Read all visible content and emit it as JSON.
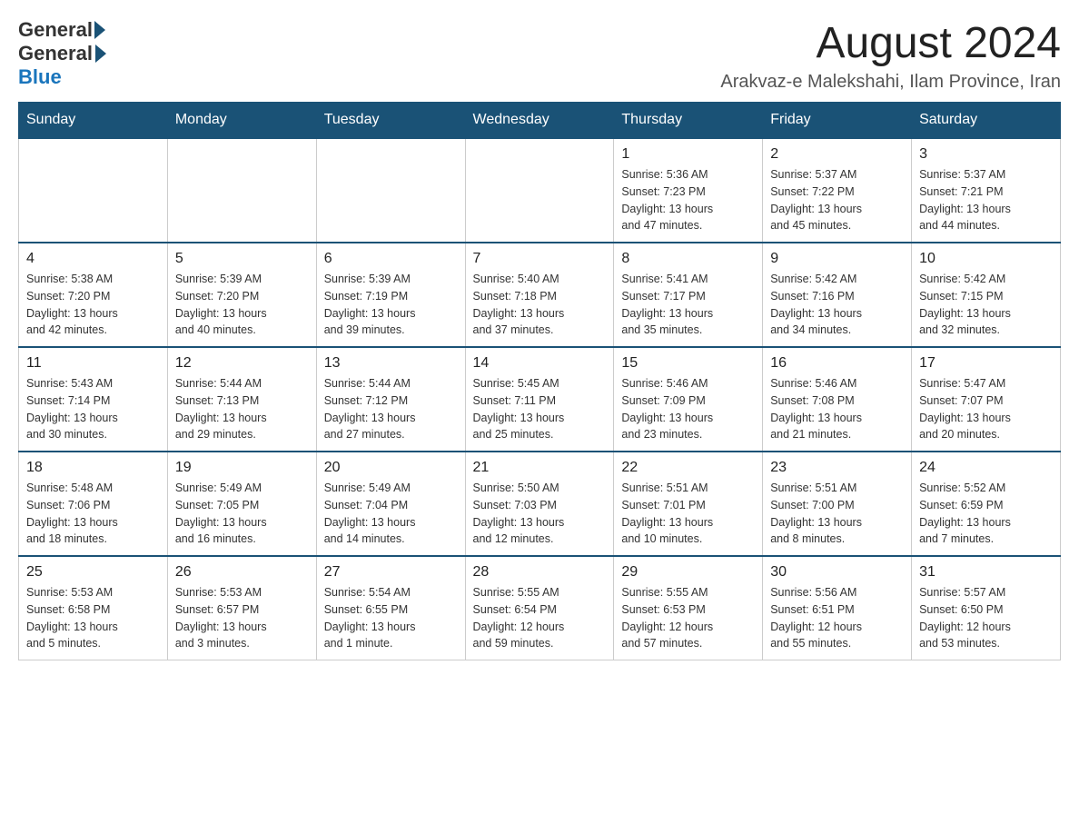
{
  "header": {
    "logo_general": "General",
    "logo_blue": "Blue",
    "month_title": "August 2024",
    "location": "Arakvaz-e Malekshahi, Ilam Province, Iran"
  },
  "days_of_week": [
    "Sunday",
    "Monday",
    "Tuesday",
    "Wednesday",
    "Thursday",
    "Friday",
    "Saturday"
  ],
  "weeks": [
    [
      {
        "day": "",
        "info": ""
      },
      {
        "day": "",
        "info": ""
      },
      {
        "day": "",
        "info": ""
      },
      {
        "day": "",
        "info": ""
      },
      {
        "day": "1",
        "info": "Sunrise: 5:36 AM\nSunset: 7:23 PM\nDaylight: 13 hours\nand 47 minutes."
      },
      {
        "day": "2",
        "info": "Sunrise: 5:37 AM\nSunset: 7:22 PM\nDaylight: 13 hours\nand 45 minutes."
      },
      {
        "day": "3",
        "info": "Sunrise: 5:37 AM\nSunset: 7:21 PM\nDaylight: 13 hours\nand 44 minutes."
      }
    ],
    [
      {
        "day": "4",
        "info": "Sunrise: 5:38 AM\nSunset: 7:20 PM\nDaylight: 13 hours\nand 42 minutes."
      },
      {
        "day": "5",
        "info": "Sunrise: 5:39 AM\nSunset: 7:20 PM\nDaylight: 13 hours\nand 40 minutes."
      },
      {
        "day": "6",
        "info": "Sunrise: 5:39 AM\nSunset: 7:19 PM\nDaylight: 13 hours\nand 39 minutes."
      },
      {
        "day": "7",
        "info": "Sunrise: 5:40 AM\nSunset: 7:18 PM\nDaylight: 13 hours\nand 37 minutes."
      },
      {
        "day": "8",
        "info": "Sunrise: 5:41 AM\nSunset: 7:17 PM\nDaylight: 13 hours\nand 35 minutes."
      },
      {
        "day": "9",
        "info": "Sunrise: 5:42 AM\nSunset: 7:16 PM\nDaylight: 13 hours\nand 34 minutes."
      },
      {
        "day": "10",
        "info": "Sunrise: 5:42 AM\nSunset: 7:15 PM\nDaylight: 13 hours\nand 32 minutes."
      }
    ],
    [
      {
        "day": "11",
        "info": "Sunrise: 5:43 AM\nSunset: 7:14 PM\nDaylight: 13 hours\nand 30 minutes."
      },
      {
        "day": "12",
        "info": "Sunrise: 5:44 AM\nSunset: 7:13 PM\nDaylight: 13 hours\nand 29 minutes."
      },
      {
        "day": "13",
        "info": "Sunrise: 5:44 AM\nSunset: 7:12 PM\nDaylight: 13 hours\nand 27 minutes."
      },
      {
        "day": "14",
        "info": "Sunrise: 5:45 AM\nSunset: 7:11 PM\nDaylight: 13 hours\nand 25 minutes."
      },
      {
        "day": "15",
        "info": "Sunrise: 5:46 AM\nSunset: 7:09 PM\nDaylight: 13 hours\nand 23 minutes."
      },
      {
        "day": "16",
        "info": "Sunrise: 5:46 AM\nSunset: 7:08 PM\nDaylight: 13 hours\nand 21 minutes."
      },
      {
        "day": "17",
        "info": "Sunrise: 5:47 AM\nSunset: 7:07 PM\nDaylight: 13 hours\nand 20 minutes."
      }
    ],
    [
      {
        "day": "18",
        "info": "Sunrise: 5:48 AM\nSunset: 7:06 PM\nDaylight: 13 hours\nand 18 minutes."
      },
      {
        "day": "19",
        "info": "Sunrise: 5:49 AM\nSunset: 7:05 PM\nDaylight: 13 hours\nand 16 minutes."
      },
      {
        "day": "20",
        "info": "Sunrise: 5:49 AM\nSunset: 7:04 PM\nDaylight: 13 hours\nand 14 minutes."
      },
      {
        "day": "21",
        "info": "Sunrise: 5:50 AM\nSunset: 7:03 PM\nDaylight: 13 hours\nand 12 minutes."
      },
      {
        "day": "22",
        "info": "Sunrise: 5:51 AM\nSunset: 7:01 PM\nDaylight: 13 hours\nand 10 minutes."
      },
      {
        "day": "23",
        "info": "Sunrise: 5:51 AM\nSunset: 7:00 PM\nDaylight: 13 hours\nand 8 minutes."
      },
      {
        "day": "24",
        "info": "Sunrise: 5:52 AM\nSunset: 6:59 PM\nDaylight: 13 hours\nand 7 minutes."
      }
    ],
    [
      {
        "day": "25",
        "info": "Sunrise: 5:53 AM\nSunset: 6:58 PM\nDaylight: 13 hours\nand 5 minutes."
      },
      {
        "day": "26",
        "info": "Sunrise: 5:53 AM\nSunset: 6:57 PM\nDaylight: 13 hours\nand 3 minutes."
      },
      {
        "day": "27",
        "info": "Sunrise: 5:54 AM\nSunset: 6:55 PM\nDaylight: 13 hours\nand 1 minute."
      },
      {
        "day": "28",
        "info": "Sunrise: 5:55 AM\nSunset: 6:54 PM\nDaylight: 12 hours\nand 59 minutes."
      },
      {
        "day": "29",
        "info": "Sunrise: 5:55 AM\nSunset: 6:53 PM\nDaylight: 12 hours\nand 57 minutes."
      },
      {
        "day": "30",
        "info": "Sunrise: 5:56 AM\nSunset: 6:51 PM\nDaylight: 12 hours\nand 55 minutes."
      },
      {
        "day": "31",
        "info": "Sunrise: 5:57 AM\nSunset: 6:50 PM\nDaylight: 12 hours\nand 53 minutes."
      }
    ]
  ]
}
